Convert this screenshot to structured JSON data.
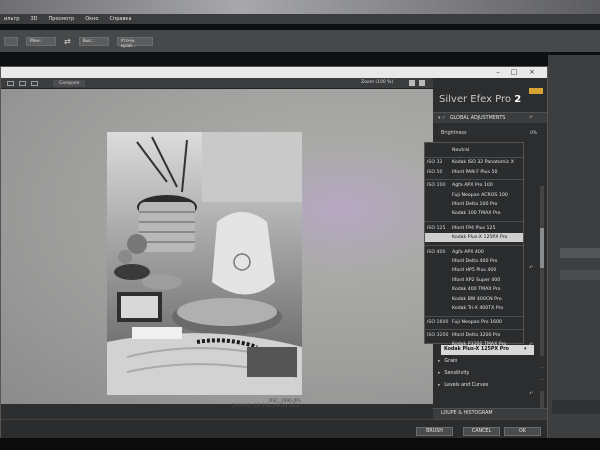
{
  "ps": {
    "menus": [
      "ильтр",
      "3D",
      "Просмотр",
      "Окно",
      "Справка"
    ],
    "opt_mode": "Мин.:",
    "opt_size": "Выс.:",
    "opt_button": "Уточн. край..."
  },
  "plugin": {
    "toolbar": {
      "compare": "Compare",
      "zoom": "Zoom (100 %)"
    },
    "title": {
      "app": "Silver Efex Pro",
      "version": "2"
    },
    "global_adjustments": "GLOBAL ADJUSTMENTS",
    "brightness": {
      "label": "Brightness",
      "value": "0%"
    },
    "grain": "Grain",
    "sensitivity": "Sensitivity",
    "levels": "Levels and Curves",
    "loupe": "LOUPE & HISTOGRAM",
    "film_selected": "Kodak Plus-X 125PX Pro",
    "photo_caption": {
      "file": "DSC_2996.JPG",
      "meta": "24.8 MP, ISO 400, NIKON D850"
    },
    "buttons": {
      "brush": "BRUSH",
      "cancel": "CANCEL",
      "ok": "OK"
    }
  },
  "dropdown": [
    {
      "iso": "",
      "name": "Neutral"
    },
    {
      "iso": "ISO 32",
      "name": "Kodak ISO 32 Panatomic X"
    },
    {
      "iso": "ISO 50",
      "name": "Ilford PAN F Plus 50"
    },
    {
      "iso": "ISO 100",
      "name": "Agfa APX Pro 100"
    },
    {
      "iso": "",
      "name": "Fuji Neopan ACROS 100"
    },
    {
      "iso": "",
      "name": "Ilford Delta 100 Pro"
    },
    {
      "iso": "",
      "name": "Kodak 100 TMAX Pro"
    },
    {
      "iso": "ISO 125",
      "name": "Ilford FP4 Plus 125"
    },
    {
      "iso": "",
      "name": "Kodak Plus-X 125PX Pro"
    },
    {
      "iso": "ISO 400",
      "name": "Agfa APX 400"
    },
    {
      "iso": "",
      "name": "Ilford Delta 400 Pro"
    },
    {
      "iso": "",
      "name": "Ilford HP5 Plus 400"
    },
    {
      "iso": "",
      "name": "Ilford XP2 Super 400"
    },
    {
      "iso": "",
      "name": "Kodak 400 TMAX Pro"
    },
    {
      "iso": "",
      "name": "Kodak BW 400CN Pro"
    },
    {
      "iso": "",
      "name": "Kodak Tri-X 400TX Pro"
    },
    {
      "iso": "ISO 1600",
      "name": "Fuji Neopan Pro 1600"
    },
    {
      "iso": "ISO 3200",
      "name": "Ilford Delta 3200 Pro"
    },
    {
      "iso": "",
      "name": "Kodak P3200 TMAX Pro"
    }
  ],
  "dropdown_selected_index": 8
}
